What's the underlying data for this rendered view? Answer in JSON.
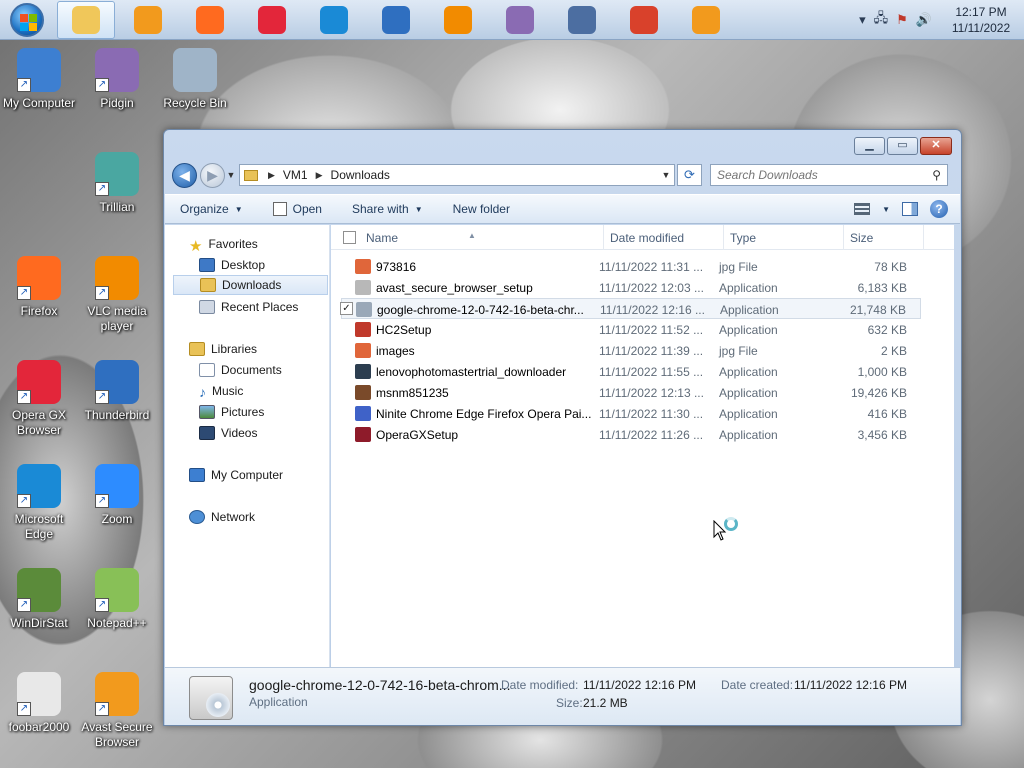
{
  "taskbar": {
    "clock_time": "12:17 PM",
    "clock_date": "11/11/2022",
    "apps": [
      {
        "name": "explorer",
        "color": "#f0c75a"
      },
      {
        "name": "media-player",
        "color": "#f29a1d"
      },
      {
        "name": "firefox",
        "color": "#ff6a1f"
      },
      {
        "name": "opera",
        "color": "#e3263a"
      },
      {
        "name": "edge",
        "color": "#1a8ad6"
      },
      {
        "name": "thunderbird",
        "color": "#2f6fc0"
      },
      {
        "name": "vlc",
        "color": "#f28b00"
      },
      {
        "name": "pidgin",
        "color": "#8a6bb3"
      },
      {
        "name": "tool",
        "color": "#4c6ea1"
      },
      {
        "name": "unknown-app",
        "color": "#d9412b"
      },
      {
        "name": "avast-browser",
        "color": "#f29a1d"
      }
    ]
  },
  "desktop": {
    "icons": [
      {
        "label": "My Computer",
        "color": "#3d7fd1"
      },
      {
        "label": "Pidgin",
        "color": "#8a6bb3"
      },
      {
        "label": "Recycle Bin",
        "color": "#9fb4c8"
      },
      {
        "label": "Trillian",
        "color": "#4aa7a1"
      },
      {
        "label": "Firefox",
        "color": "#ff6a1f"
      },
      {
        "label": "VLC media player",
        "color": "#f28b00"
      },
      {
        "label": "Opera GX Browser",
        "color": "#e3263a"
      },
      {
        "label": "Thunderbird",
        "color": "#2f6fc0"
      },
      {
        "label": "Microsoft Edge",
        "color": "#1a8ad6"
      },
      {
        "label": "Zoom",
        "color": "#2d8cff"
      },
      {
        "label": "WinDirStat",
        "color": "#5b8b3a"
      },
      {
        "label": "Notepad++",
        "color": "#88c057"
      },
      {
        "label": "foobar2000",
        "color": "#e8e8e8"
      },
      {
        "label": "Avast Secure Browser",
        "color": "#f29a1d"
      }
    ]
  },
  "window": {
    "breadcrumb": [
      "VM1",
      "Downloads"
    ],
    "search_placeholder": "Search Downloads",
    "toolbar": {
      "organize": "Organize",
      "open": "Open",
      "share_with": "Share with",
      "new_folder": "New folder"
    },
    "nav": {
      "favorites": "Favorites",
      "desktop": "Desktop",
      "downloads": "Downloads",
      "recent_places": "Recent Places",
      "libraries": "Libraries",
      "documents": "Documents",
      "music": "Music",
      "pictures": "Pictures",
      "videos": "Videos",
      "my_computer": "My Computer",
      "network": "Network"
    },
    "columns": {
      "name": "Name",
      "date_modified": "Date modified",
      "type": "Type",
      "size": "Size"
    },
    "files": [
      {
        "name": "973816",
        "date": "11/11/2022 11:31 ...",
        "type": "jpg File",
        "size": "78 KB",
        "color": "#e0663a"
      },
      {
        "name": "avast_secure_browser_setup",
        "date": "11/11/2022 12:03 ...",
        "type": "Application",
        "size": "6,183 KB",
        "color": "#b8b8b8"
      },
      {
        "name": "google-chrome-12-0-742-16-beta-chr...",
        "date": "11/11/2022 12:16 ...",
        "type": "Application",
        "size": "21,748 KB",
        "color": "#9aa8b8"
      },
      {
        "name": "HC2Setup",
        "date": "11/11/2022 11:52 ...",
        "type": "Application",
        "size": "632 KB",
        "color": "#c0392b"
      },
      {
        "name": "images",
        "date": "11/11/2022 11:39 ...",
        "type": "jpg File",
        "size": "2 KB",
        "color": "#e0663a"
      },
      {
        "name": "lenovophotomastertrial_downloader",
        "date": "11/11/2022 11:55 ...",
        "type": "Application",
        "size": "1,000 KB",
        "color": "#2c3e50"
      },
      {
        "name": "msnm851235",
        "date": "11/11/2022 12:13 ...",
        "type": "Application",
        "size": "19,426 KB",
        "color": "#7a4a2a"
      },
      {
        "name": "Ninite Chrome Edge Firefox Opera Pai...",
        "date": "11/11/2022 11:30 ...",
        "type": "Application",
        "size": "416 KB",
        "color": "#3f62c8"
      },
      {
        "name": "OperaGXSetup",
        "date": "11/11/2022 11:26 ...",
        "type": "Application",
        "size": "3,456 KB",
        "color": "#8e1b2a"
      }
    ],
    "details": {
      "filename": "google-chrome-12-0-742-16-beta-chrom...",
      "type": "Application",
      "date_modified_label": "Date modified:",
      "date_modified": "11/11/2022 12:16 PM",
      "date_created_label": "Date created:",
      "date_created": "11/11/2022 12:16 PM",
      "size_label": "Size:",
      "size": "21.2 MB"
    }
  }
}
